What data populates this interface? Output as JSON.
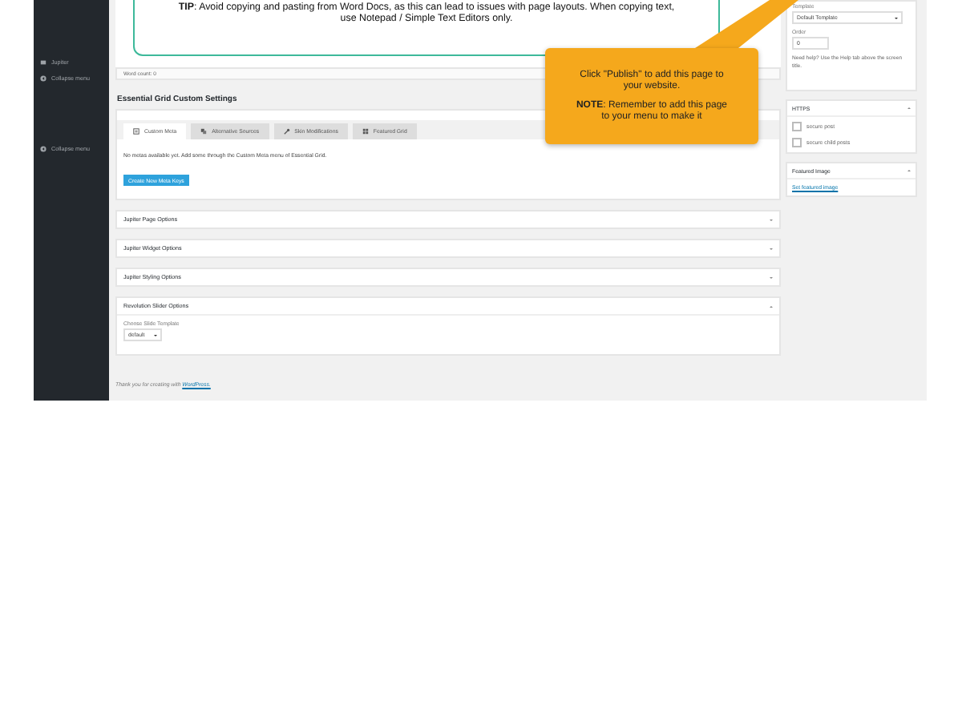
{
  "sidebar": {
    "items": [
      {
        "label": "Jupiter",
        "kind": "theme"
      },
      {
        "label": "Collapse menu",
        "kind": "collapse"
      },
      {
        "label": "Collapse menu",
        "kind": "collapse"
      }
    ]
  },
  "editor": {
    "tip": "**TIP**: Avoid copying and pasting from Word Docs, as this can lead to issues with page layouts. When copying text, use Notepad / Simple Text Editors only.",
    "word_count": "Word count: 0"
  },
  "essential_grid": {
    "title": "Essential Grid Custom Settings",
    "tabs": [
      {
        "label": "Custom Meta",
        "kind": "meta",
        "selected": true
      },
      {
        "label": "Alternative Sources",
        "kind": "sources",
        "selected": false
      },
      {
        "label": "Skin Modifications",
        "kind": "skin",
        "selected": false
      },
      {
        "label": "Featured Grid",
        "kind": "grid",
        "selected": false
      }
    ],
    "message": "No metas available yet. Add some through the Custom Meta menu of Essential Grid.",
    "button": "Create New Meta Keys"
  },
  "panels": [
    {
      "title": "Jupiter Page Options",
      "expanded": false
    },
    {
      "title": "Jupiter Widget Options",
      "expanded": false
    },
    {
      "title": "Jupiter Styling Options",
      "expanded": false
    },
    {
      "title": "Revolution Slider Options",
      "expanded": true,
      "field_label": "Choose Slide Template",
      "select_value": "default"
    }
  ],
  "footer": {
    "text": "Thank you for creating with",
    "link": "WordPress."
  },
  "page_attributes": {
    "template_label": "Template",
    "template_value": "Default Template",
    "order_label": "Order",
    "order_value": "0",
    "help": "Need help? Use the Help tab above the screen title."
  },
  "https": {
    "title": "HTTPS",
    "options": [
      {
        "label": "secure post",
        "checked": false
      },
      {
        "label": "secure child posts",
        "checked": false
      }
    ]
  },
  "featured_image": {
    "title": "Featured Image",
    "link": "Set featured image"
  },
  "callout": {
    "text": "Click \"Publish\" to add this page to your website.",
    "note": "**NOTE**: Remember to add this page to your menu to make it"
  }
}
